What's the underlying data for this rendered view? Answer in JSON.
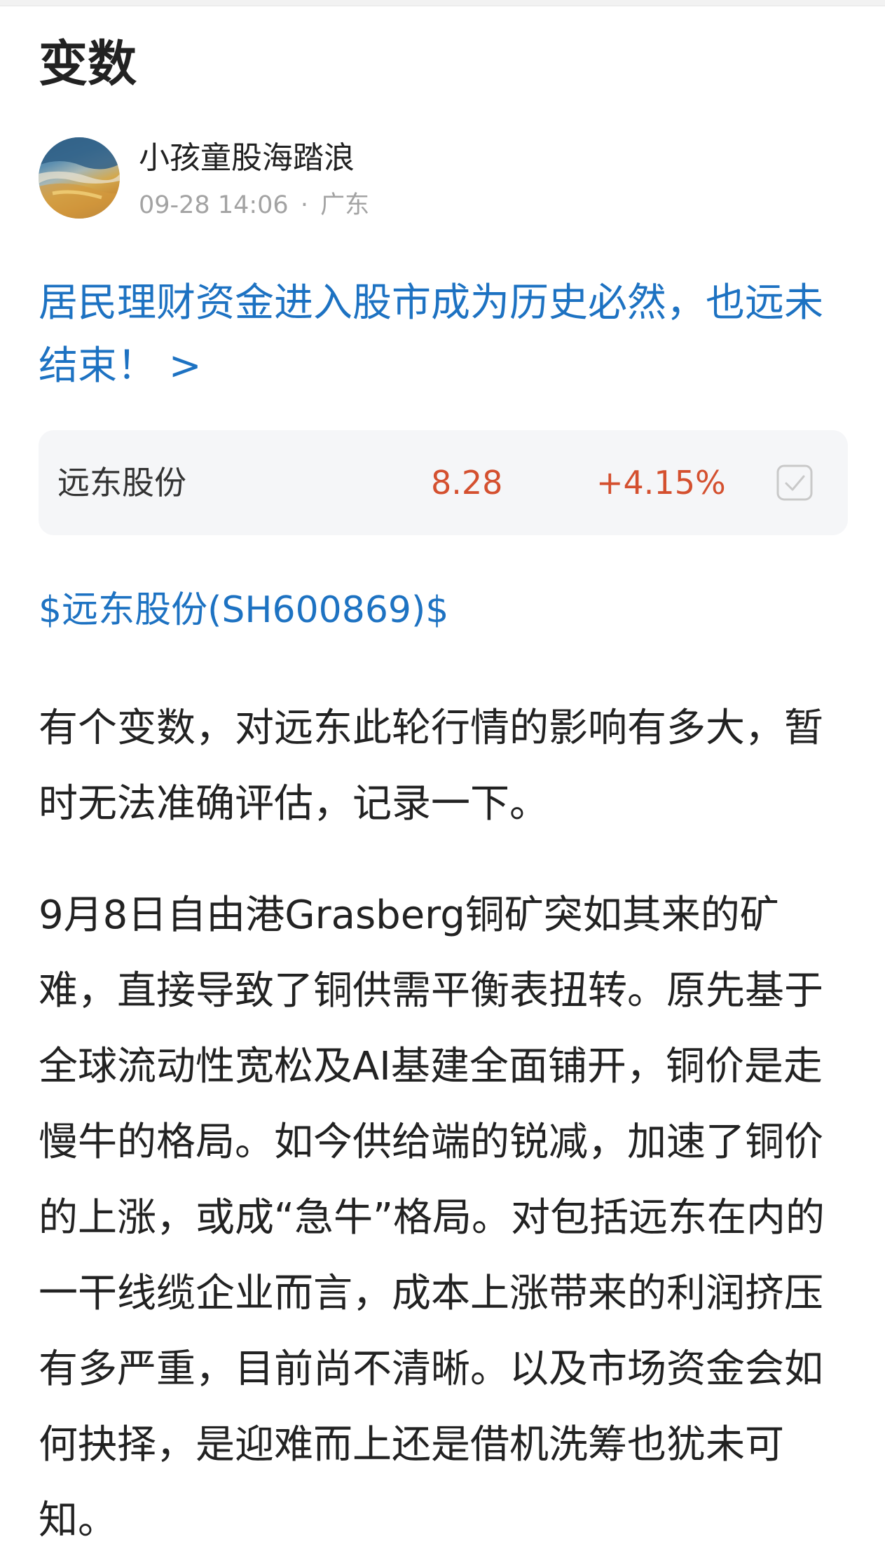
{
  "post": {
    "title": "变数"
  },
  "author": {
    "name": "小孩童股海踏浪",
    "date": "09-28 14:06",
    "separator": "·",
    "location": "广东"
  },
  "headline_link": {
    "text": "居民理财资金进入股市成为历史必然，也远未结束！ >"
  },
  "stock_quote": {
    "name": "远东股份",
    "price": "8.28",
    "change": "+4.15%",
    "color_up": "#d4502f",
    "icon": "checkbox-icon"
  },
  "stock_tag": {
    "text": "$远东股份(SH600869)$"
  },
  "body": {
    "paragraph_1": "有个变数，对远东此轮行情的影响有多大，暂时无法准确评估，记录一下。",
    "paragraph_2": "9月8日自由港Grasberg铜矿突如其来的矿难，直接导致了铜供需平衡表扭转。原先基于全球流动性宽松及AI基建全面铺开，铜价是走慢牛的格局。如今供给端的锐减，加速了铜价的上涨，或成“急牛”格局。对包括远东在内的一干线缆企业而言，成本上涨带来的利润挤压有多严重，目前尚不清晰。以及市场资金会如何抉择，是迎难而上还是借机洗筹也犹未可知。"
  },
  "colors": {
    "link": "#1d72c2",
    "text": "#222222",
    "meta": "#a3a3a3",
    "card_bg": "#f5f6f8"
  }
}
